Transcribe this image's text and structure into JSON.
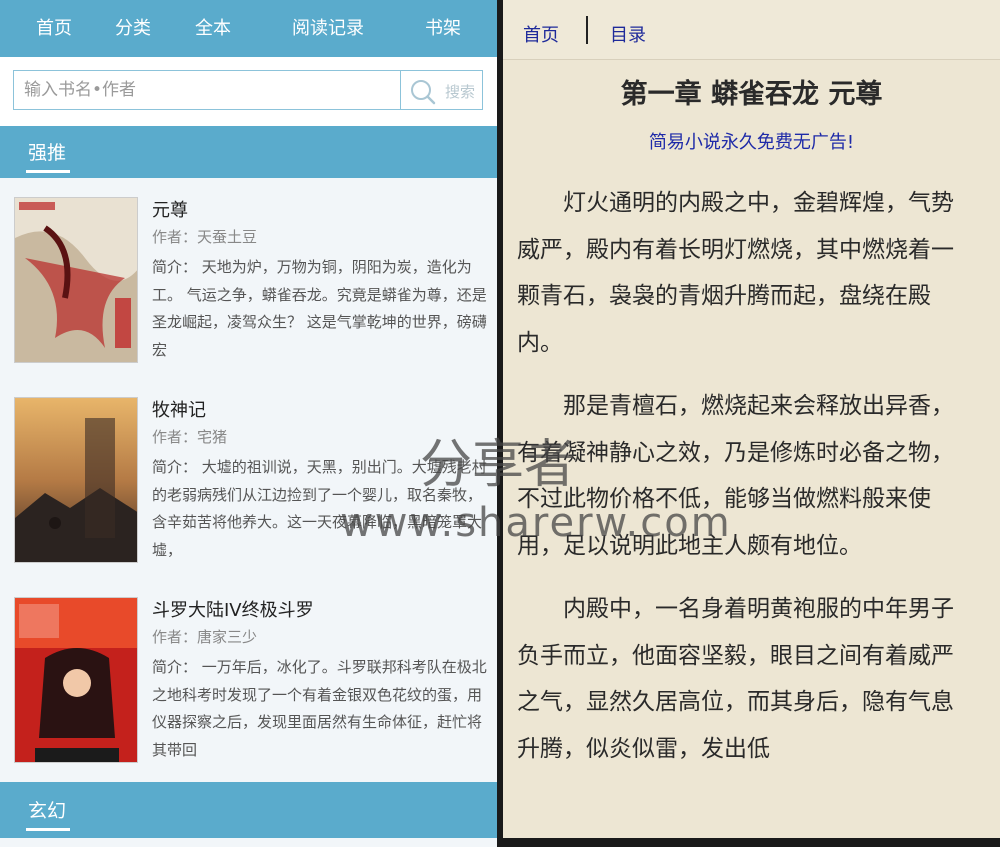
{
  "left_pane": {
    "nav": {
      "items": [
        "首页",
        "分类",
        "全本",
        "阅读记录",
        "书架"
      ]
    },
    "search": {
      "placeholder": "输入书名•作者",
      "button_label": "搜索"
    },
    "featured_section": {
      "title": "强推",
      "books": [
        {
          "title": "元尊",
          "author": "作者：天蚕土豆",
          "description": "简介：  天地为炉，万物为铜，阴阳为炭，造化为工。  气运之争，蟒雀吞龙。究竟是蟒雀为尊，还是圣龙崛起，凌驾众生？  这是气掌乾坤的世界，磅礴宏"
        },
        {
          "title": "牧神记",
          "author": "作者：宅猪",
          "description": "简介：  大墟的祖训说，天黑，别出门。大墟残老村的老弱病残们从江边捡到了一个婴儿，取名秦牧，含辛茹苦将他养大。这一天夜幕降临，黑暗笼罩大墟，"
        },
        {
          "title": "斗罗大陆IV终极斗罗",
          "author": "作者：唐家三少",
          "description": "简介：  一万年后，冰化了。斗罗联邦科考队在极北之地科考时发现了一个有着金银双色花纹的蛋，用仪器探察之后，发现里面居然有生命体征，赶忙将其带回"
        }
      ]
    },
    "next_section": {
      "title": "玄幻"
    }
  },
  "right_pane": {
    "nav": {
      "home": "首页",
      "toc": "目录"
    },
    "chapter_title": "第一章 蟒雀吞龙  元尊",
    "ad_text": "简易小说永久免费无广告!",
    "paragraphs": [
      "灯火通明的内殿之中，金碧辉煌，气势威严，殿内有着长明灯燃烧，其中燃烧着一颗青石，袅袅的青烟升腾而起，盘绕在殿内。",
      "那是青檀石，燃烧起来会释放出异香，有着凝神静心之效，乃是修炼时必备之物，不过此物价格不低，能够当做燃料般来使用，足以说明此地主人颇有地位。",
      "内殿中，一名身着明黄袍服的中年男子负手而立，他面容坚毅，眼目之间有着威严之气，显然久居高位，而其身后，隐有气息升腾，似炎似雷，发出低"
    ]
  },
  "watermark": {
    "line1": "分享者",
    "line2": "www.sharerw.com"
  },
  "colors": {
    "accent_blue": "#5aabcc",
    "reader_bg": "#ede6d3",
    "link_blue": "#1e2a9a"
  }
}
